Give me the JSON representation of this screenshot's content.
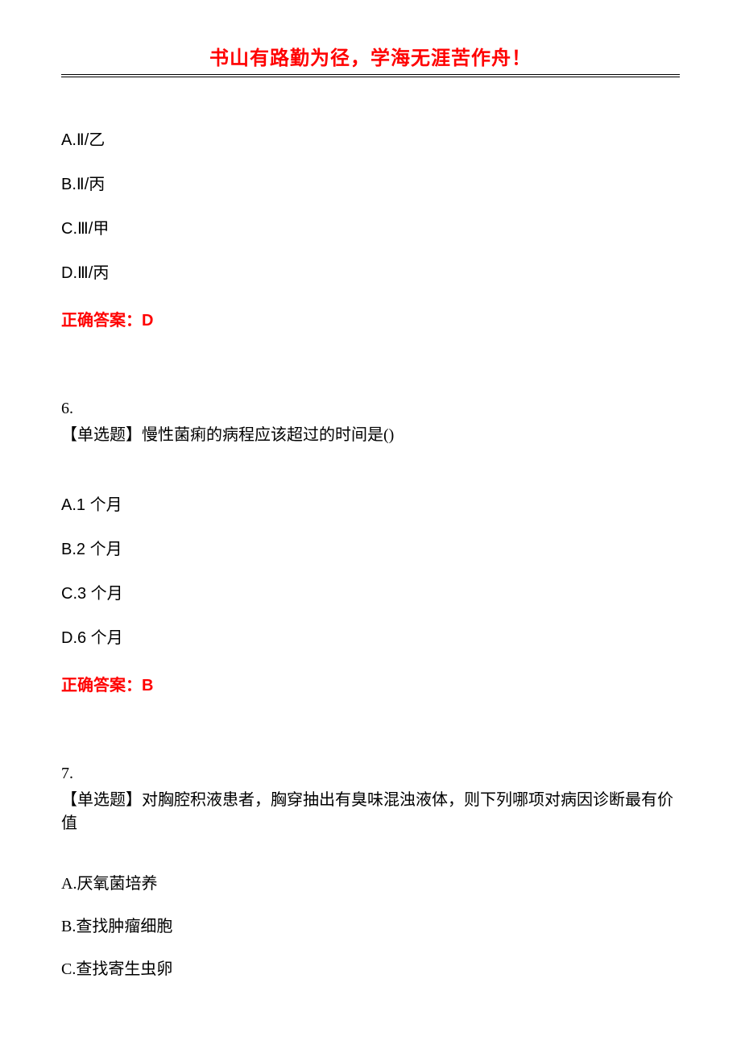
{
  "header": "书山有路勤为径，学海无涯苦作舟！",
  "q5": {
    "options": {
      "a": "A.Ⅱ/乙",
      "b": "B.Ⅱ/丙",
      "c": "C.Ⅲ/甲",
      "d": "D.Ⅲ/丙"
    },
    "answer": "正确答案：D"
  },
  "q6": {
    "number": "6.",
    "text": "【单选题】慢性菌痢的病程应该超过的时间是()",
    "options": {
      "a": "A.1 个月",
      "b": "B.2 个月",
      "c": "C.3 个月",
      "d": "D.6 个月"
    },
    "answer": "正确答案：B"
  },
  "q7": {
    "number": "7.",
    "text": "【单选题】对胸腔积液患者，胸穿抽出有臭味混浊液体，则下列哪项对病因诊断最有价值",
    "options": {
      "a": "A.厌氧菌培养",
      "b": "B.查找肿瘤细胞",
      "c": "C.查找寄生虫卵"
    }
  }
}
